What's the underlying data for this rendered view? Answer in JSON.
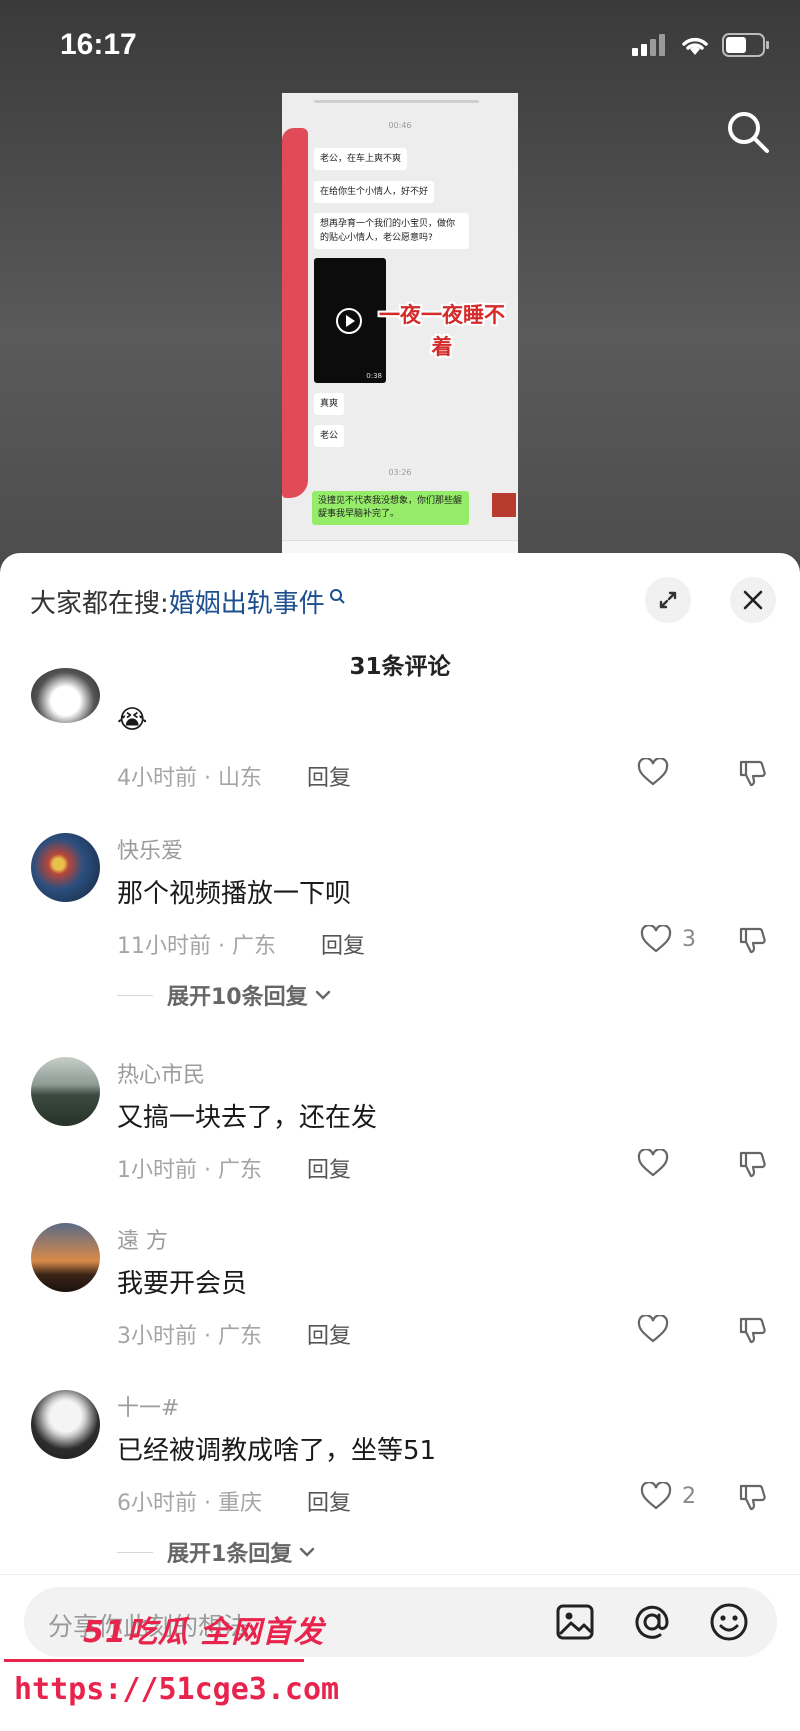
{
  "status": {
    "time": "16:17"
  },
  "screenshot": {
    "time1": "00:46",
    "bubble1": "老公，在车上爽不爽",
    "bubble2": "在给你生个小情人，好不好",
    "bubble3": "想再孕育一个我们的小宝贝，做你的贴心小情人，老公愿意吗?",
    "video_duration": "0:38",
    "caption": "一夜一夜睡不着",
    "bubble4": "真爽",
    "bubble5": "老公",
    "time2": "03:26",
    "green_bubble": "没撞见不代表我没想象，你们那些龌龊事我早脑补完了。"
  },
  "sheet": {
    "hot_search_label": "大家都在搜:",
    "hot_search_keyword": "婚姻出轨事件",
    "comment_count": "31条评论"
  },
  "comments": [
    {
      "username": "",
      "text": "😭",
      "time": "4小时前",
      "region": "山东",
      "reply_label": "回复",
      "likes": ""
    },
    {
      "username": "快乐爱",
      "text": "那个视频播放一下呗",
      "time": "11小时前",
      "region": "广东",
      "reply_label": "回复",
      "likes": "3",
      "expand": "展开10条回复"
    },
    {
      "username": "热心市民",
      "text": "又搞一块去了，还在发",
      "time": "1小时前",
      "region": "广东",
      "reply_label": "回复",
      "likes": ""
    },
    {
      "username": "遠 方",
      "text": "我要开会员",
      "time": "3小时前",
      "region": "广东",
      "reply_label": "回复",
      "likes": ""
    },
    {
      "username": "十一#",
      "text": "已经被调教成啥了，坐等51",
      "time": "6小时前",
      "region": "重庆",
      "reply_label": "回复",
      "likes": "2",
      "expand": "展开1条回复"
    }
  ],
  "input": {
    "placeholder": "分享你此刻的想法"
  },
  "watermark": {
    "line1": "51吃瓜 全网首发",
    "line2": "https://51cge3.com"
  },
  "colors": {
    "accent_red": "#e8244d",
    "keyword_blue": "#1d4f8f",
    "wechat_green": "#95ec69"
  }
}
